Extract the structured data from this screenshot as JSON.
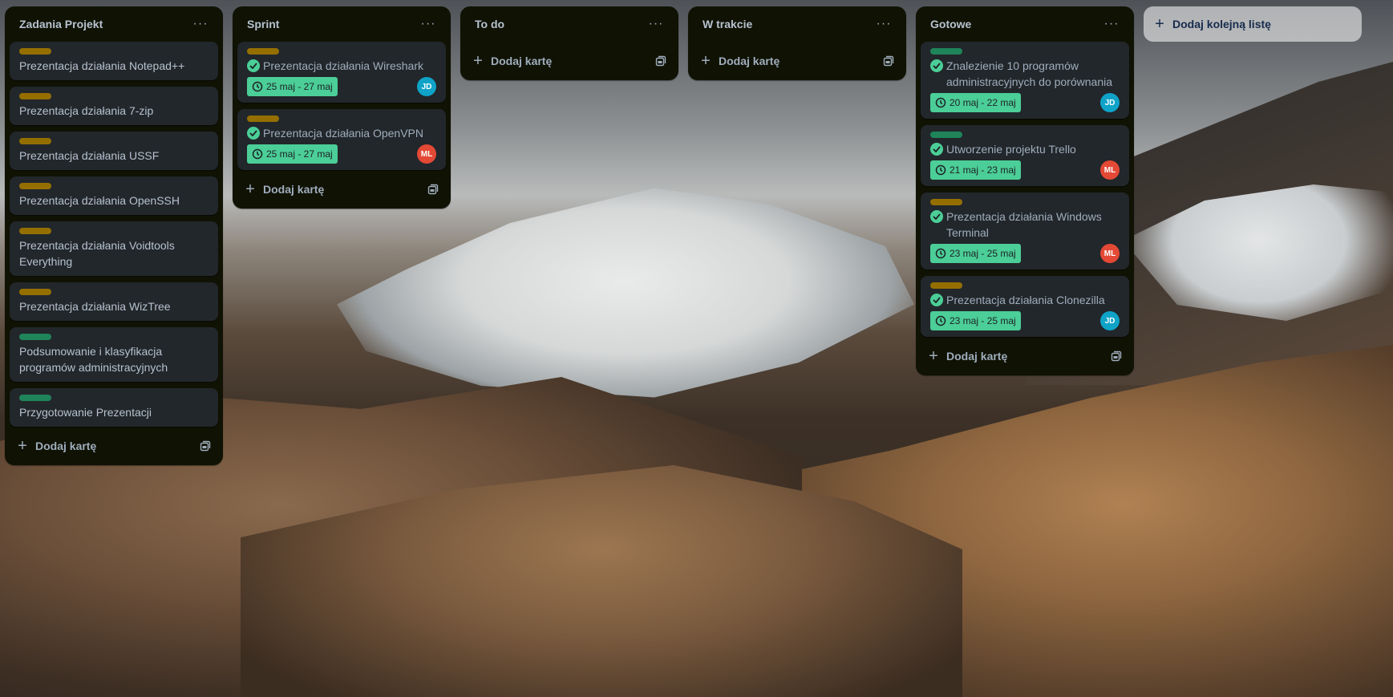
{
  "colors": {
    "label_yellow": "#946f00",
    "label_green": "#1f845a",
    "date_green": "#4bce97",
    "avatar_jd": "#0fa3c8",
    "avatar_ml": "#e34935"
  },
  "add_card_label": "Dodaj kartę",
  "add_list_label": "Dodaj kolejną listę",
  "menu_glyph": "···",
  "lists": [
    {
      "title": "Zadania Projekt",
      "cards": [
        {
          "label": "yellow",
          "title": "Prezentacja działania Notepad++"
        },
        {
          "label": "yellow",
          "title": "Prezentacja działania 7-zip"
        },
        {
          "label": "yellow",
          "title": "Prezentacja działania USSF"
        },
        {
          "label": "yellow",
          "title": "Prezentacja działania OpenSSH"
        },
        {
          "label": "yellow",
          "title": "Prezentacja działania Voidtools Everything"
        },
        {
          "label": "yellow",
          "title": "Prezentacja działania WizTree"
        },
        {
          "label": "green",
          "title": "Podsumowanie i klasyfikacja programów administracyjnych"
        },
        {
          "label": "green",
          "title": "Przygotowanie Prezentacji"
        }
      ]
    },
    {
      "title": "Sprint",
      "cards": [
        {
          "label": "yellow",
          "title": "Prezentacja działania Wireshark",
          "done": true,
          "date": "25 maj - 27 maj",
          "member": "JD"
        },
        {
          "label": "yellow",
          "title": "Prezentacja działania OpenVPN",
          "done": true,
          "date": "25 maj - 27 maj",
          "member": "ML"
        }
      ]
    },
    {
      "title": "To do",
      "cards": []
    },
    {
      "title": "W trakcie",
      "cards": []
    },
    {
      "title": "Gotowe",
      "cards": [
        {
          "label": "green",
          "title": "Znalezienie 10 programów administracyjnych do porównania",
          "done": true,
          "date": "20 maj - 22 maj",
          "member": "JD"
        },
        {
          "label": "green",
          "title": "Utworzenie projektu Trello",
          "done": true,
          "date": "21 maj - 23 maj",
          "member": "ML"
        },
        {
          "label": "yellow",
          "title": "Prezentacja działania Windows Terminal",
          "done": true,
          "date": "23 maj - 25 maj",
          "member": "ML"
        },
        {
          "label": "yellow",
          "title": "Prezentacja działania Clonezilla",
          "done": true,
          "date": "23 maj - 25 maj",
          "member": "JD"
        }
      ]
    }
  ]
}
